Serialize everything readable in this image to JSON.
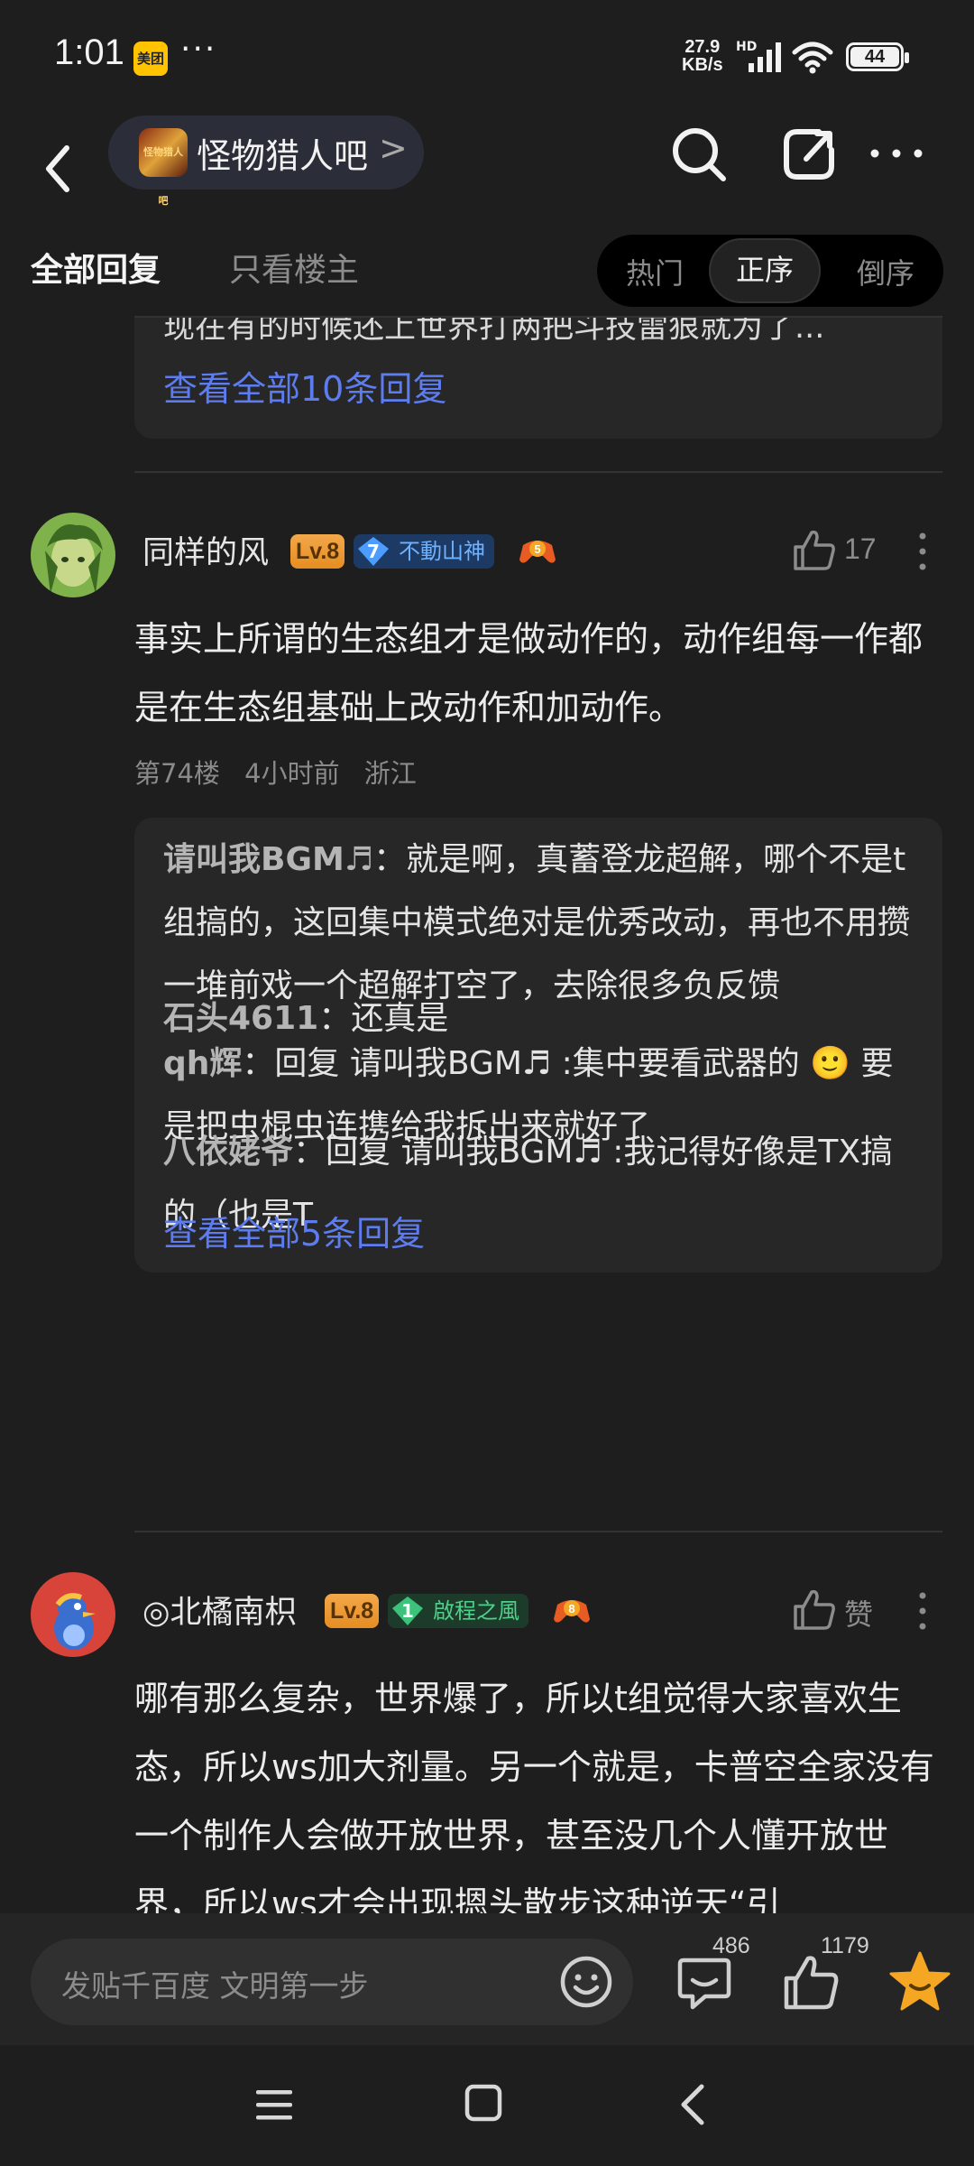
{
  "status_bar": {
    "time": "1:01",
    "meituan_badge": "美团",
    "more_dots": "···",
    "net_speed_value": "27.9",
    "net_speed_unit": "KB/s",
    "hd_label": "HD",
    "battery": "44"
  },
  "nav": {
    "forum_name": "怪物猎人吧",
    "forum_avatar_text": "怪物猎人吧",
    "chevron": ">"
  },
  "tabs": {
    "all_replies": "全部回复",
    "op_only": "只看楼主",
    "sort_hot": "热门",
    "sort_seq": "正序",
    "sort_rev": "倒序"
  },
  "prev_post": {
    "snippet": "现在有的时候还上世界打两把斗技雷狠就为了...",
    "view_all": "查看全部10条回复"
  },
  "post1": {
    "username": "同样的风",
    "level": "Lv.8",
    "badge_num": "7",
    "badge_text": "不動山神",
    "game_badge_num": "5",
    "likes": "17",
    "body": "事实上所谓的生态组才是做动作的，动作组每一作都是在生态组基础上改动作和加动作。",
    "floor": "第74楼",
    "time": "4小时前",
    "location": "浙江",
    "replies": [
      {
        "name": "请叫我BGM♬",
        "text": "就是啊，真蓄登龙超解，哪个不是t组搞的，这回集中模式绝对是优秀改动，再也不用攒一堆前戏一个超解打空了，去除很多负反馈"
      },
      {
        "name": "石头4611",
        "text": "还真是"
      },
      {
        "name": "qh辉",
        "text": "回复 请叫我BGM♬ :集中要看武器的 🙂 要是把虫棍虫连携给我拆出来就好了"
      },
      {
        "name": "八依姥爷",
        "text": "回复 请叫我BGM♬ :我记得好像是TX搞的（也是T"
      }
    ],
    "reply_sep": "：",
    "view_all": "查看全部5条回复"
  },
  "post2": {
    "username": "◎北橘南枳",
    "level": "Lv.8",
    "badge_num": "1",
    "badge_text": "啟程之風",
    "game_badge_num": "8",
    "likes": "赞",
    "body": "哪有那么复杂，世界爆了，所以t组觉得大家喜欢生态，所以ws加大剂量。另一个就是，卡普空全家没有一个制作人会做开放世界，甚至没几个人懂开放世界，所以ws才会出现摁头散步这种逆天“引"
  },
  "bottom_bar": {
    "placeholder": "发贴千百度 文明第一步",
    "comment_count": "486",
    "like_count": "1179"
  },
  "colors": {
    "background": "#1e1e1e",
    "link_blue": "#5c7cf0",
    "level_orange": "#e58d22",
    "star_gold": "#f5a623"
  },
  "icons": [
    "back-icon",
    "search-icon",
    "share-edit-icon",
    "more-icon",
    "thumb-up-icon",
    "kebab-icon",
    "emoji-icon",
    "comment-icon",
    "star-icon",
    "menu-icon",
    "home-icon",
    "nav-back-icon"
  ]
}
